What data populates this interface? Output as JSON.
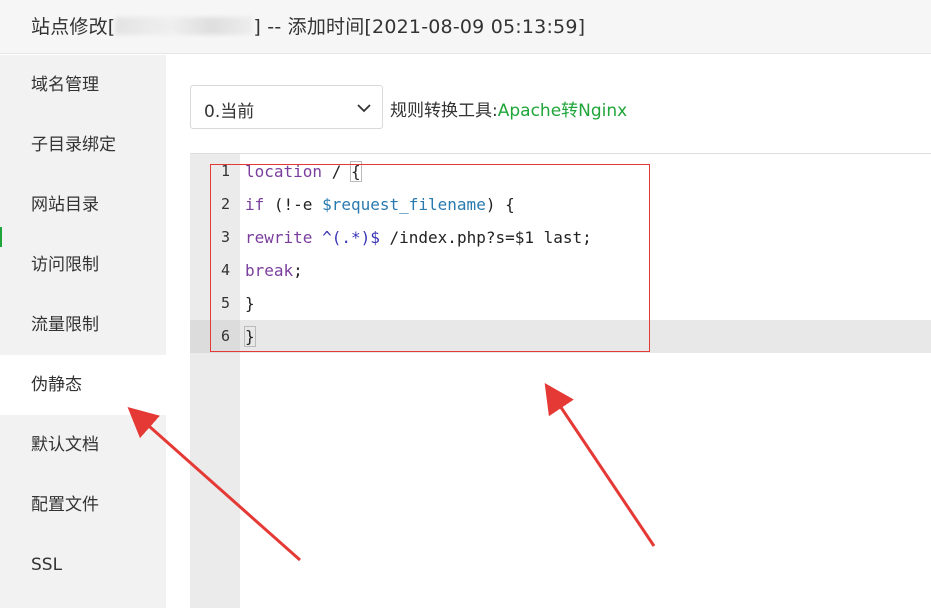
{
  "header": {
    "title_prefix": "站点修改[",
    "title_suffix": "] -- 添加时间[2021-08-09 05:13:59]"
  },
  "sidebar": {
    "items": [
      {
        "label": "域名管理"
      },
      {
        "label": "子目录绑定"
      },
      {
        "label": "网站目录"
      },
      {
        "label": "访问限制"
      },
      {
        "label": "流量限制"
      },
      {
        "label": "伪静态",
        "active": true
      },
      {
        "label": "默认文档"
      },
      {
        "label": "配置文件"
      },
      {
        "label": "SSL"
      }
    ]
  },
  "toolbar": {
    "select_value": "0.当前",
    "tool_label": "规则转换工具:",
    "tool_link": "Apache转Nginx"
  },
  "editor": {
    "lines": [
      {
        "num": "1",
        "text": "location / {"
      },
      {
        "num": "2",
        "text": "if (!-e $request_filename) {"
      },
      {
        "num": "3",
        "text": "rewrite ^(.*)$ /index.php?s=$1 last;"
      },
      {
        "num": "4",
        "text": "break;"
      },
      {
        "num": "5",
        "text": "}"
      },
      {
        "num": "6",
        "text": "}"
      }
    ],
    "active_line": 6
  },
  "colors": {
    "accent_green": "#20a53a",
    "annotation_red": "#e53935"
  },
  "icons": {
    "select_arrow": "chevron-down-icon"
  }
}
